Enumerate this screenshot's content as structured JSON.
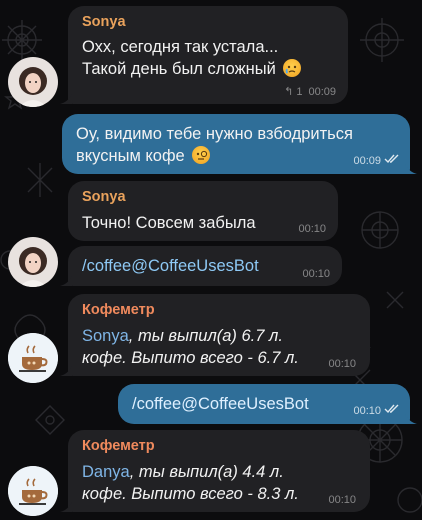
{
  "theme": {
    "incoming_bubble": "#212124",
    "outgoing_bubble": "#2f6e98",
    "sender_sonya": "#e9a25c",
    "sender_bot": "#f08a5d",
    "link": "#8ec9f5"
  },
  "messages": [
    {
      "id": "m1",
      "direction": "in",
      "sender": "Sonya",
      "lines": [
        "Охх, сегодня так устала...",
        "Такой день был сложный"
      ],
      "emoji": "crying-face-icon",
      "reply_count": "1",
      "time": "00:09"
    },
    {
      "id": "m2",
      "direction": "out",
      "lines": [
        "Оу, видимо тебе нужно взбодриться",
        "вкусным кофе"
      ],
      "emoji": "monocle-face-icon",
      "time": "00:09",
      "status": "read"
    },
    {
      "id": "m3",
      "direction": "in",
      "sender": "Sonya",
      "lines": [
        "Точно! Совсем забыла"
      ],
      "time": "00:10"
    },
    {
      "id": "m4",
      "direction": "in",
      "lines": [
        "/coffee@CoffeeUsesBot"
      ],
      "time": "00:10"
    },
    {
      "id": "m5",
      "direction": "in",
      "sender": "Кофеметр",
      "mention": "Sonya",
      "line1_rest": ", ты выпил(а) 6.7 л.",
      "line2": "кофе. Выпито всего - 6.7 л.",
      "time": "00:10"
    },
    {
      "id": "m6",
      "direction": "out",
      "lines": [
        "/coffee@CoffeeUsesBot"
      ],
      "time": "00:10",
      "status": "read"
    },
    {
      "id": "m7",
      "direction": "in",
      "sender": "Кофеметр",
      "mention": "Danya",
      "line1_rest": ", ты выпил(а) 4.4 л.",
      "line2": "кофе. Выпито всего - 8.3 л.",
      "time": "00:10"
    }
  ]
}
